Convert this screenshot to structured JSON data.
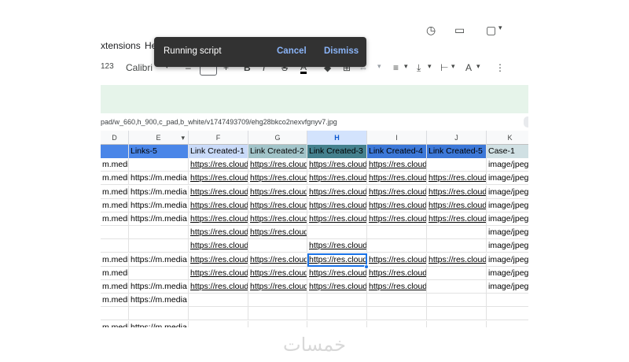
{
  "menu": {
    "extensions": "xtensions",
    "help": "He"
  },
  "toolbar": {
    "zoom_fragment": "123",
    "font": "Calibri",
    "minus": "–",
    "plus": "+",
    "bold": "B",
    "italic": "I",
    "strike": "S",
    "text_color": "A",
    "more": "⋮"
  },
  "snackbar": {
    "message": "Running script",
    "cancel": "Cancel",
    "dismiss": "Dismiss"
  },
  "url_bar": {
    "text": "pad/w_660,h_900,c_pad,b_white/v1747493709/ehg28bkco2nexvfgnyv7.jpg"
  },
  "columns": [
    "D",
    "E",
    "F",
    "G",
    "H",
    "I",
    "J",
    "K"
  ],
  "header_row": [
    "",
    "Links-5",
    "Link Created-1",
    "Link Created-2",
    "Link Created-3",
    "Link Created-4",
    "Link Created-5",
    "Case-1"
  ],
  "rows": [
    [
      "m.media",
      "",
      "https://res.cloudi",
      "https://res.cloudi",
      "https://res.cloudi",
      "https://res.cloudi",
      "",
      "image/jpeg"
    ],
    [
      "m.media",
      "https://m.media",
      "https://res.cloudi",
      "https://res.cloudi",
      "https://res.cloudi",
      "https://res.cloudi",
      "https://res.cloudi",
      "image/jpeg"
    ],
    [
      "m.media",
      "https://m.media",
      "https://res.cloudi",
      "https://res.cloudi",
      "https://res.cloudi",
      "https://res.cloudi",
      "https://res.cloudi",
      "image/jpeg"
    ],
    [
      "m.media",
      "https://m.media",
      "https://res.cloudi",
      "https://res.cloudi",
      "https://res.cloudi",
      "https://res.cloudi",
      "https://res.cloudi",
      "image/jpeg"
    ],
    [
      "m.media",
      "https://m.media",
      "https://res.cloudi",
      "https://res.cloudi",
      "https://res.cloudi",
      "https://res.cloudi",
      "https://res.cloudi",
      "image/jpeg"
    ],
    [
      "",
      "",
      "https://res.cloudi",
      "https://res.cloudi",
      "",
      "",
      "",
      "image/jpeg"
    ],
    [
      "",
      "",
      "https://res.cloudi",
      "",
      "https://res.cloudi",
      "",
      "",
      "image/jpeg"
    ],
    [
      "m.media",
      "https://m.media",
      "https://res.cloudi",
      "https://res.cloudi",
      "https://res.cloudi",
      "https://res.cloudi",
      "https://res.cloudi",
      "image/jpeg"
    ],
    [
      "m.media",
      "",
      "https://res.cloudi",
      "https://res.cloudi",
      "https://res.cloudi",
      "https://res.cloudi",
      "",
      "image/jpeg"
    ],
    [
      "m.media",
      "https://m.media",
      "https://res.cloudi",
      "https://res.cloudi",
      "https://res.cloudi",
      "https://res.cloudi",
      "",
      "image/jpeg"
    ],
    [
      "m.media",
      "https://m.media",
      "",
      "",
      "",
      "",
      "",
      ""
    ],
    [
      "",
      "",
      "",
      "",
      "",
      "",
      "",
      ""
    ],
    [
      "m.media",
      "https://m.media",
      "",
      "",
      "",
      "",
      "",
      ""
    ]
  ],
  "watermark": "خمسات"
}
